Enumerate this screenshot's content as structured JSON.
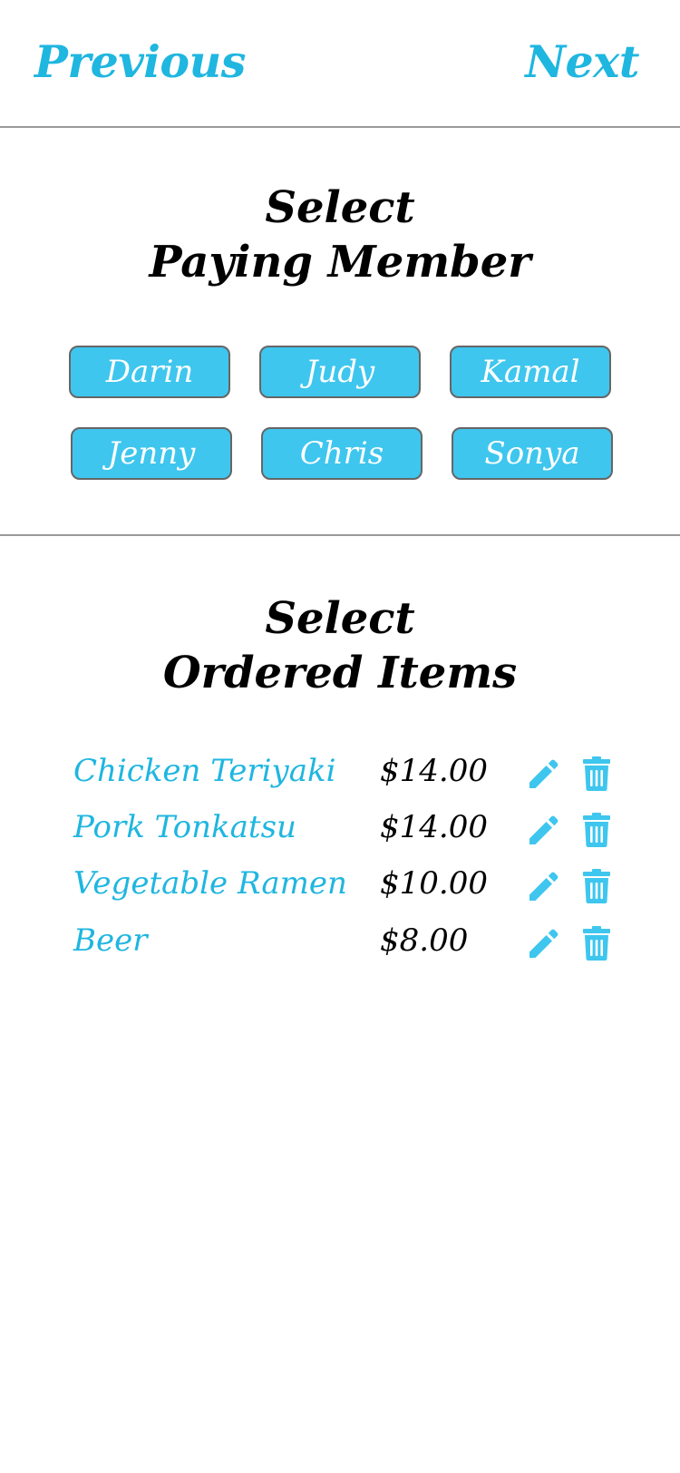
{
  "nav": {
    "previous_label": "Previous",
    "next_label": "Next"
  },
  "member_section": {
    "title_line1": "Select",
    "title_line2": "Paying Member",
    "members": [
      "Darin",
      "Judy",
      "Kamal",
      "Jenny",
      "Chris",
      "Sonya"
    ]
  },
  "items_section": {
    "title_line1": "Select",
    "title_line2": "Ordered Items",
    "items": [
      {
        "name": "Chicken Teriyaki",
        "price": "$14.00",
        "edit_icon": "pencil-icon",
        "delete_icon": "trash-icon"
      },
      {
        "name": "Pork Tonkatsu",
        "price": "$14.00",
        "edit_icon": "pencil-icon",
        "delete_icon": "trash-icon"
      },
      {
        "name": "Vegetable Ramen",
        "price": "$10.00",
        "edit_icon": "pencil-icon",
        "delete_icon": "trash-icon"
      },
      {
        "name": "Beer",
        "price": "$8.00",
        "edit_icon": "pencil-icon",
        "delete_icon": "trash-icon"
      }
    ]
  },
  "colors": {
    "accent": "#1fb6e0",
    "button_fill": "#3ec6ee",
    "button_border": "#666666",
    "divider": "#999999",
    "title_text": "#000000"
  }
}
